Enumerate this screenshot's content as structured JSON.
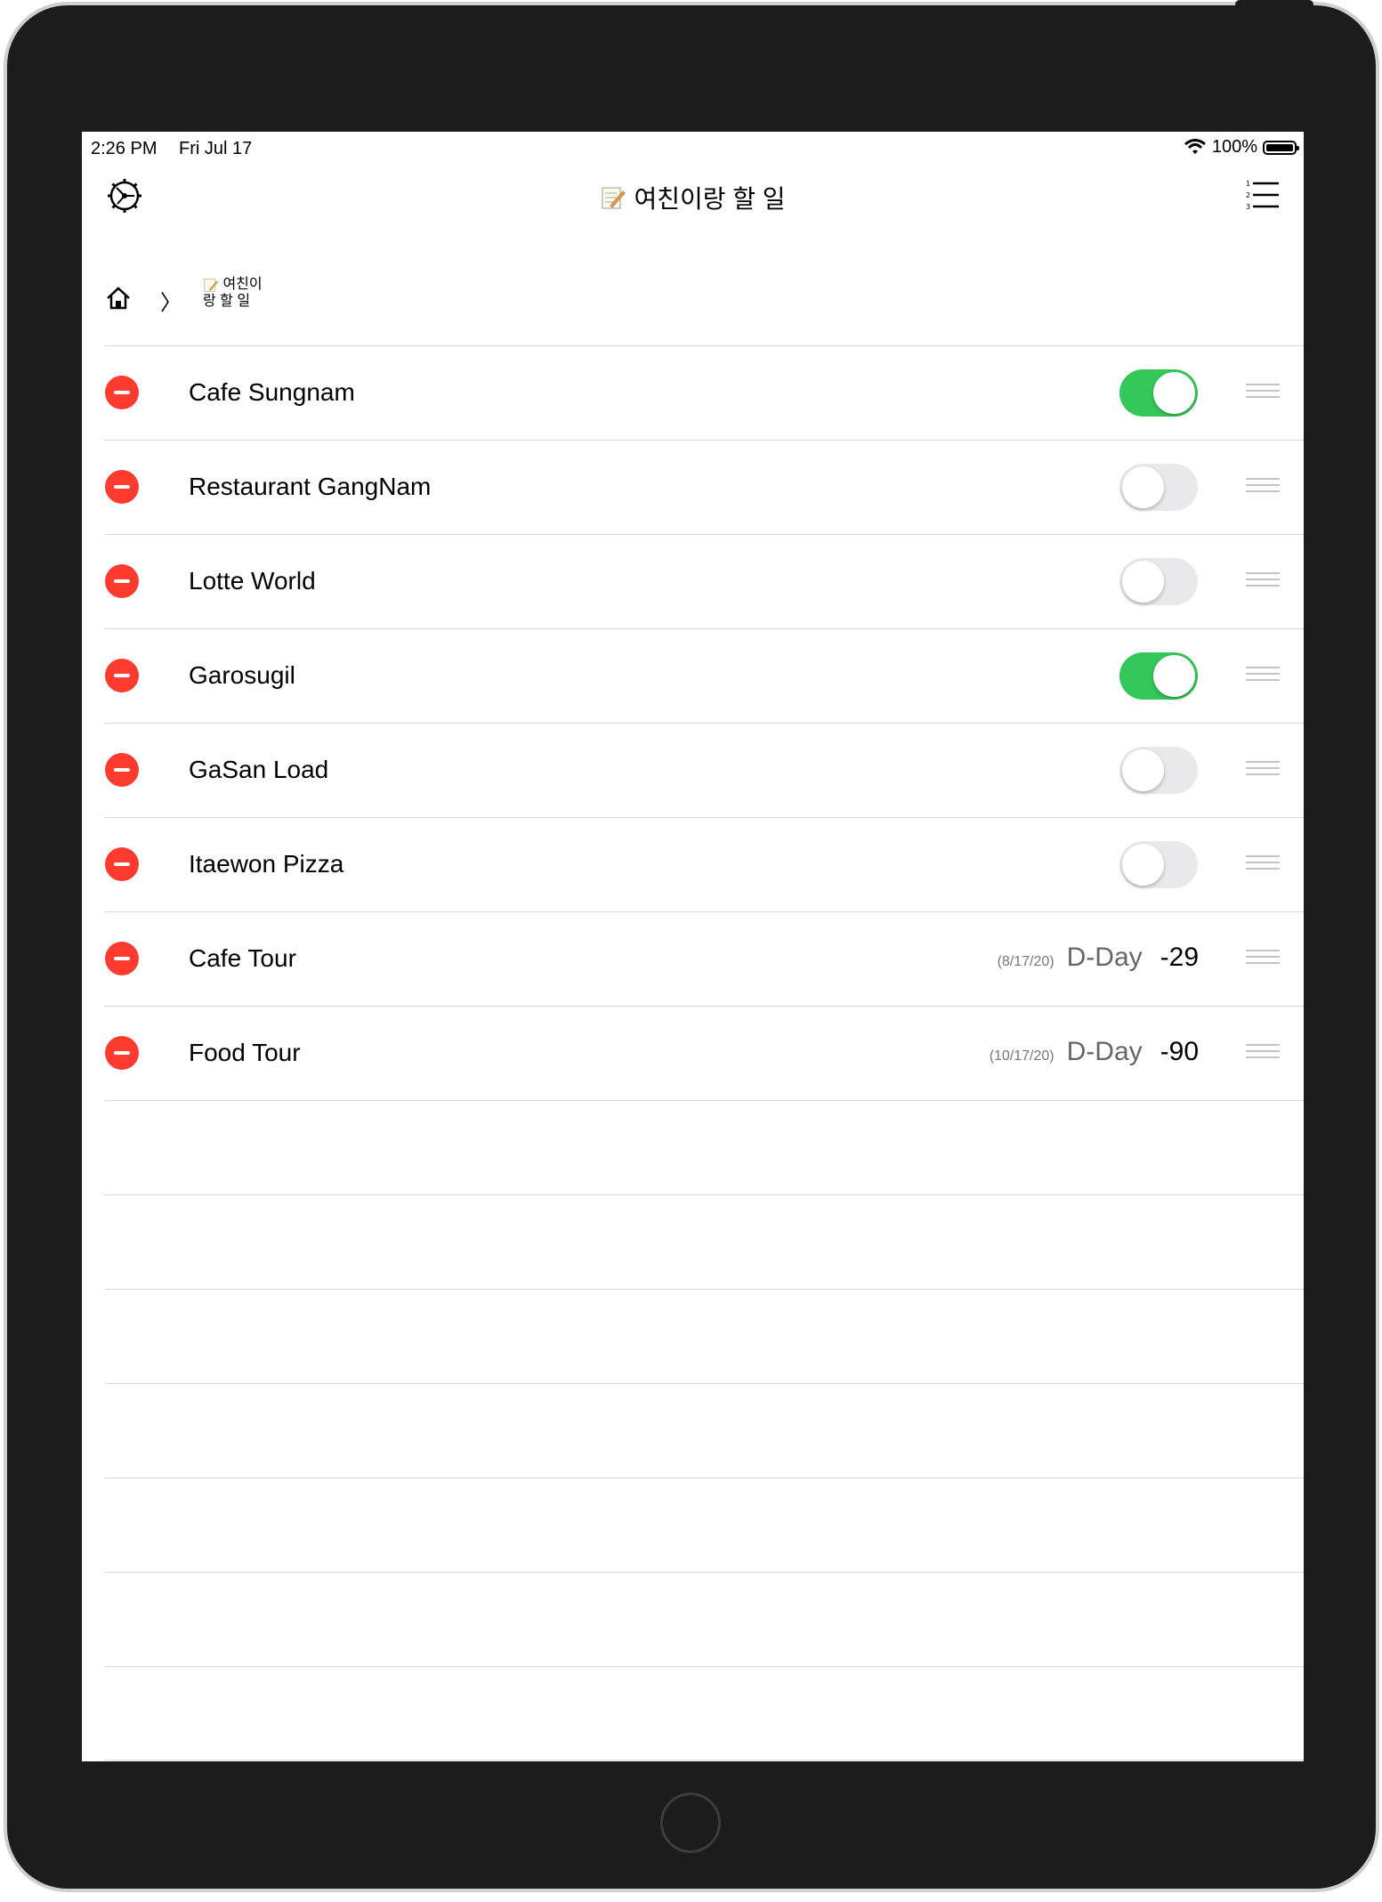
{
  "status_bar": {
    "time": "2:26 PM",
    "date": "Fri Jul 17",
    "battery": "100%"
  },
  "navbar": {
    "title": "여친이랑 할 일",
    "left_icon": "gear-icon",
    "right_icon": "numbered-list-icon"
  },
  "breadcrumb": {
    "home_icon": "home-icon",
    "separator": "〉",
    "current": "여친이랑 할 일"
  },
  "items": [
    {
      "title": "Cafe Sungnam",
      "type": "toggle",
      "on": true
    },
    {
      "title": "Restaurant GangNam",
      "type": "toggle",
      "on": false
    },
    {
      "title": "Lotte World",
      "type": "toggle",
      "on": false
    },
    {
      "title": "Garosugil",
      "type": "toggle",
      "on": true
    },
    {
      "title": "GaSan Load",
      "type": "toggle",
      "on": false
    },
    {
      "title": "Itaewon Pizza",
      "type": "toggle",
      "on": false
    },
    {
      "title": "Cafe Tour",
      "type": "dday",
      "date": "(8/17/20)",
      "label": "D-Day",
      "value": "-29"
    },
    {
      "title": "Food Tour",
      "type": "dday",
      "date": "(10/17/20)",
      "label": "D-Day",
      "value": "-90"
    }
  ],
  "colors": {
    "toggle_on": "#34c759",
    "delete": "#ff3b30",
    "device": "#1c1c1c"
  }
}
